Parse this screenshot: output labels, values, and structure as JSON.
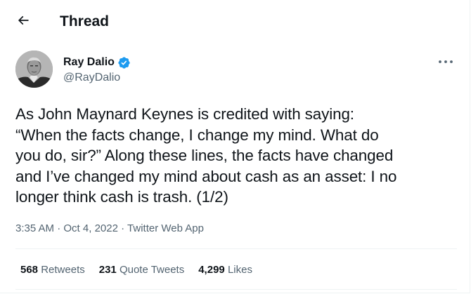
{
  "header": {
    "title": "Thread",
    "back_icon": "arrow-left-icon"
  },
  "author": {
    "display_name": "Ray Dalio",
    "handle": "@RayDalio",
    "verified": true,
    "verified_color": "#1d9bf0"
  },
  "tweet": {
    "lines": [
      "As John Maynard Keynes is credited with saying:",
      "“When the facts change, I change my mind. What do",
      "you do, sir?” Along these lines, the facts have changed",
      "and I’ve changed my mind about cash as an asset: I no",
      "longer think cash is trash. (1/2)"
    ],
    "time": "3:35 AM",
    "separator": "·",
    "date": "Oct 4, 2022",
    "source": "Twitter Web App"
  },
  "stats": {
    "retweets": {
      "count": "568",
      "label": "Retweets"
    },
    "quote_tweets": {
      "count": "231",
      "label": "Quote Tweets"
    },
    "likes": {
      "count": "4,299",
      "label": "Likes"
    }
  },
  "colors": {
    "text_primary": "#0f1419",
    "text_secondary": "#536471",
    "divider": "#eff3f4",
    "accent": "#1d9bf0"
  }
}
